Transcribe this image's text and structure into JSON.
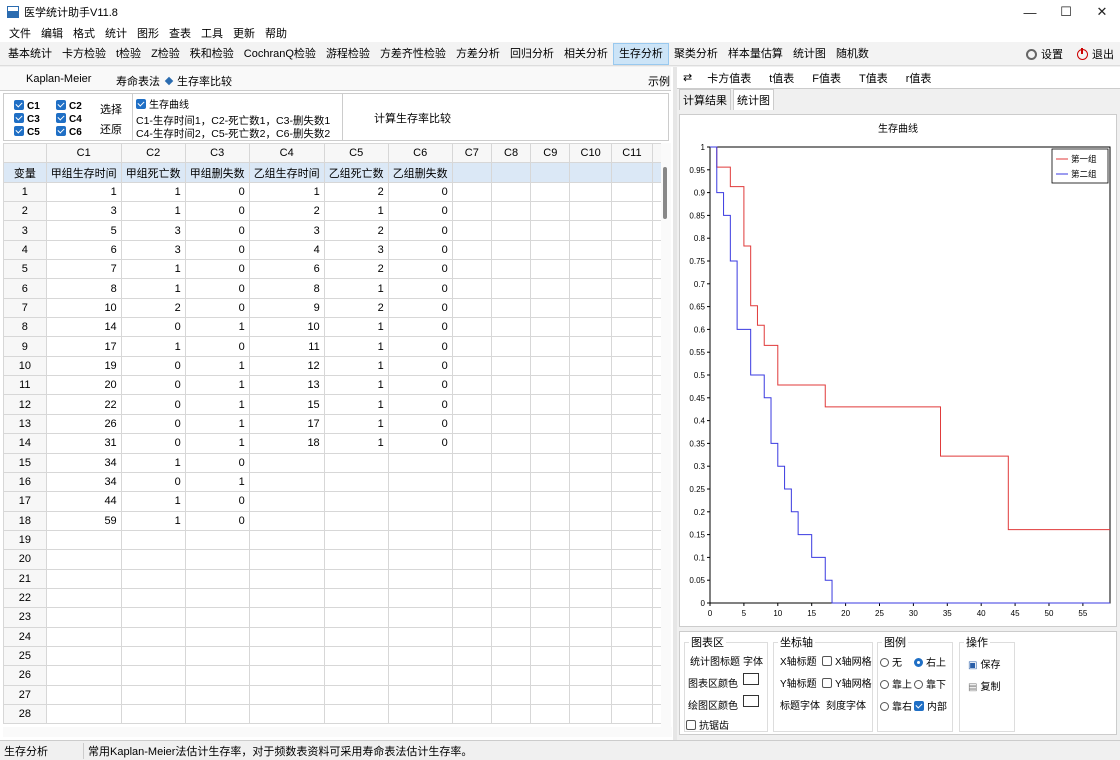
{
  "window": {
    "title": "医学统计助手V11.8",
    "controls": [
      "—",
      "☐",
      "✕"
    ]
  },
  "menu": [
    "文件",
    "编辑",
    "格式",
    "统计",
    "图形",
    "查表",
    "工具",
    "更新",
    "帮助"
  ],
  "toolbar": {
    "items": [
      "基本统计",
      "卡方检验",
      "t检验",
      "Z检验",
      "秩和检验",
      "CochranQ检验",
      "游程检验",
      "方差齐性检验",
      "方差分析",
      "回归分析",
      "相关分析",
      "生存分析",
      "聚类分析",
      "样本量估算",
      "统计图",
      "随机数"
    ],
    "active": "生存分析",
    "settings": "设置",
    "exit": "退出"
  },
  "options": {
    "km": "Kaplan-Meier",
    "life": "寿命表法",
    "compare": "生存率比较",
    "example": "示例"
  },
  "selector": {
    "columns": [
      "C1",
      "C2",
      "C3",
      "C4",
      "C5",
      "C6"
    ],
    "select": "选择",
    "restore": "还原",
    "curve_check": "生存曲线",
    "desc1": "C1-生存时间1，C2-死亡数1，C3-删失数1",
    "desc2": "C4-生存时间2，C5-死亡数2，C6-删失数2",
    "compute": "计算生存率比较"
  },
  "sheet": {
    "col_headers": [
      "C1",
      "C2",
      "C3",
      "C4",
      "C5",
      "C6",
      "C7",
      "C8",
      "C9",
      "C10",
      "C11"
    ],
    "var_label": "变量",
    "var_names": [
      "甲组生存时间",
      "甲组死亡数",
      "甲组删失数",
      "乙组生存时间",
      "乙组死亡数",
      "乙组删失数",
      "",
      "",
      "",
      "",
      ""
    ],
    "rows": [
      [
        "1",
        "1",
        "0",
        "1",
        "2",
        "0"
      ],
      [
        "3",
        "1",
        "0",
        "2",
        "1",
        "0"
      ],
      [
        "5",
        "3",
        "0",
        "3",
        "2",
        "0"
      ],
      [
        "6",
        "3",
        "0",
        "4",
        "3",
        "0"
      ],
      [
        "7",
        "1",
        "0",
        "6",
        "2",
        "0"
      ],
      [
        "8",
        "1",
        "0",
        "8",
        "1",
        "0"
      ],
      [
        "10",
        "2",
        "0",
        "9",
        "2",
        "0"
      ],
      [
        "14",
        "0",
        "1",
        "10",
        "1",
        "0"
      ],
      [
        "17",
        "1",
        "0",
        "11",
        "1",
        "0"
      ],
      [
        "19",
        "0",
        "1",
        "12",
        "1",
        "0"
      ],
      [
        "20",
        "0",
        "1",
        "13",
        "1",
        "0"
      ],
      [
        "22",
        "0",
        "1",
        "15",
        "1",
        "0"
      ],
      [
        "26",
        "0",
        "1",
        "17",
        "1",
        "0"
      ],
      [
        "31",
        "0",
        "1",
        "18",
        "1",
        "0"
      ],
      [
        "34",
        "1",
        "0",
        "",
        "",
        ""
      ],
      [
        "34",
        "0",
        "1",
        "",
        "",
        ""
      ],
      [
        "44",
        "1",
        "0",
        "",
        "",
        ""
      ],
      [
        "59",
        "1",
        "0",
        "",
        "",
        ""
      ]
    ],
    "row_numbers": [
      "1",
      "2",
      "3",
      "4",
      "5",
      "6",
      "7",
      "8",
      "9",
      "10",
      "11",
      "12",
      "13",
      "14",
      "15",
      "16",
      "17",
      "18",
      "19",
      "20",
      "21",
      "22",
      "23",
      "24",
      "25",
      "26",
      "27",
      "28"
    ]
  },
  "right_tabs": [
    "卡方值表",
    "t值表",
    "F值表",
    "T值表",
    "r值表"
  ],
  "result_tabs": [
    "计算结果",
    "统计图"
  ],
  "chart_data": {
    "type": "line",
    "step": true,
    "title": "生存曲线",
    "xlim": [
      0,
      59
    ],
    "ylim": [
      0,
      1
    ],
    "xticks": [
      0,
      5,
      10,
      15,
      20,
      25,
      30,
      35,
      40,
      45,
      50,
      55
    ],
    "yticks": [
      0,
      0.05,
      0.1,
      0.15,
      0.2,
      0.25,
      0.3,
      0.35,
      0.4,
      0.45,
      0.5,
      0.55,
      0.6,
      0.65,
      0.7,
      0.75,
      0.8,
      0.85,
      0.9,
      0.95,
      1
    ],
    "legend_position": "top-right",
    "series": [
      {
        "name": "第一组",
        "color": "#e03a3a",
        "x": [
          0,
          1,
          3,
          5,
          6,
          7,
          8,
          10,
          17,
          34,
          44,
          59
        ],
        "y": [
          1,
          0.956,
          0.913,
          0.783,
          0.652,
          0.609,
          0.565,
          0.478,
          0.43,
          0.322,
          0.161,
          0.161
        ]
      },
      {
        "name": "第二组",
        "color": "#3a3ae0",
        "x": [
          0,
          1,
          2,
          3,
          4,
          6,
          8,
          9,
          10,
          11,
          12,
          13,
          15,
          17,
          18,
          59
        ],
        "y": [
          1,
          0.9,
          0.85,
          0.75,
          0.6,
          0.5,
          0.45,
          0.35,
          0.3,
          0.25,
          0.2,
          0.15,
          0.1,
          0.05,
          0,
          0
        ]
      }
    ]
  },
  "panel": {
    "chart_area": "图表区",
    "chart_title": "统计图标题",
    "font": "字体",
    "chart_color": "图表区颜色",
    "plot_color": "绘图区颜色",
    "antialias": "抗锯齿",
    "axes": "坐标轴",
    "x_title": "X轴标题",
    "x_grid": "X轴网格",
    "y_title": "Y轴标题",
    "y_grid": "Y轴网格",
    "title_font": "标题字体",
    "tick_font": "刻度字体",
    "legend": "图例",
    "none": "无",
    "top_right": "右上",
    "top": "靠上",
    "bottom": "靠下",
    "right": "靠右",
    "inside": "内部",
    "ops": "操作",
    "save": "保存",
    "copy": "复制"
  },
  "status": {
    "left": "生存分析",
    "message": "常用Kaplan-Meier法估计生存率，对于频数表资料可采用寿命表法估计生存率。"
  }
}
